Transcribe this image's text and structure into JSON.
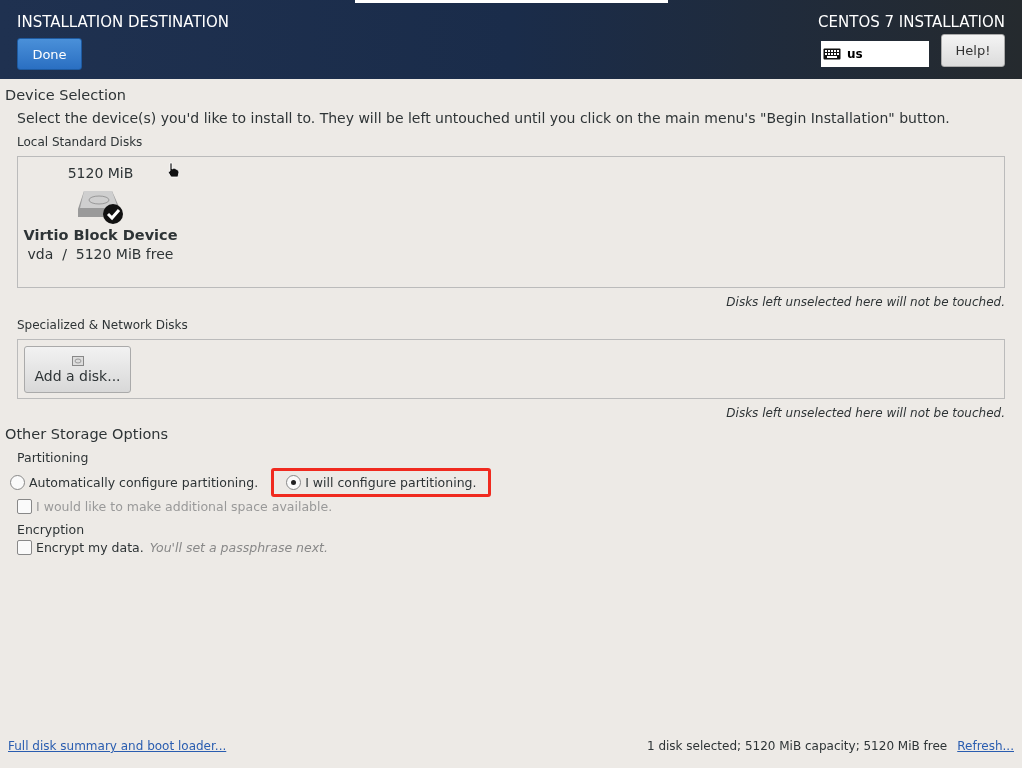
{
  "header": {
    "title": "INSTALLATION DESTINATION",
    "done_button": "Done",
    "product": "CENTOS 7 INSTALLATION",
    "keyboard_layout": "us",
    "help_button": "Help!"
  },
  "device_selection": {
    "heading": "Device Selection",
    "intro": "Select the device(s) you'd like to install to.  They will be left untouched until you click on the main menu's \"Begin Installation\" button.",
    "local_disks": {
      "heading": "Local Standard Disks",
      "disks": [
        {
          "size": "5120 MiB",
          "name": "Virtio Block Device",
          "detail": "vda  /  5120 MiB free",
          "selected": true
        }
      ],
      "note": "Disks left unselected here will not be touched."
    },
    "network_disks": {
      "heading": "Specialized & Network Disks",
      "add_button": "Add a disk...",
      "note": "Disks left unselected here will not be touched."
    }
  },
  "other_storage": {
    "heading": "Other Storage Options",
    "partitioning": {
      "heading": "Partitioning",
      "options": [
        {
          "label": "Automatically configure partitioning.",
          "selected": false,
          "highlighted": false
        },
        {
          "label": "I will configure partitioning.",
          "selected": true,
          "highlighted": true
        }
      ],
      "reclaim": {
        "label": "I would like to make additional space available.",
        "checked": false,
        "disabled": true
      }
    },
    "encryption": {
      "heading": "Encryption",
      "label": "Encrypt my data.",
      "hint": "You'll set a passphrase next.",
      "checked": false
    }
  },
  "footer": {
    "summary_link": "Full disk summary and boot loader...",
    "status": "1 disk selected; 5120 MiB capacity; 5120 MiB free",
    "refresh_link": "Refresh..."
  }
}
